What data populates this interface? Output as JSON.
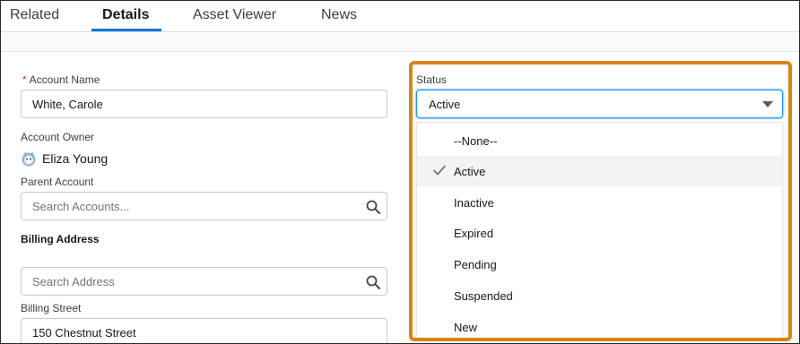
{
  "tabs": [
    {
      "label": "Related"
    },
    {
      "label": "Details"
    },
    {
      "label": "Asset Viewer"
    },
    {
      "label": "News"
    }
  ],
  "form": {
    "account_name": {
      "label": "Account Name",
      "required_mark": "*",
      "value": "White, Carole"
    },
    "account_owner": {
      "label": "Account Owner",
      "name": "Eliza Young"
    },
    "parent_account": {
      "label": "Parent Account",
      "placeholder": "Search Accounts..."
    },
    "billing_section_title": "Billing Address",
    "billing_search": {
      "placeholder": "Search Address"
    },
    "billing_street": {
      "label": "Billing Street",
      "value": "150 Chestnut Street"
    }
  },
  "status": {
    "label": "Status",
    "selected": "Active",
    "options": [
      "--None--",
      "Active",
      "Inactive",
      "Expired",
      "Pending",
      "Suspended",
      "New"
    ]
  },
  "colors": {
    "accent": "#0176d3",
    "highlight_border": "#d88512",
    "required": "#c23934"
  },
  "icons": {
    "search": "search-icon",
    "caret": "caret-down-icon",
    "check": "check-icon",
    "avatar": "user-avatar-icon"
  }
}
